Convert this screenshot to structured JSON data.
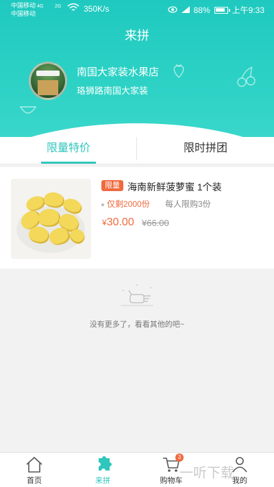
{
  "status_bar": {
    "carrier_1": "中国移动",
    "carrier_2": "中国移动",
    "signal_1": "4G",
    "signal_2": "2G",
    "speed": "350K/s",
    "battery": "88%",
    "time": "上午9:33"
  },
  "header": {
    "title": "来拼",
    "store_name": "南国大家装水果店",
    "store_address": "珞狮路南国大家装"
  },
  "tabs": [
    {
      "label": "限量特价",
      "active": true
    },
    {
      "label": "限时拼团",
      "active": false
    }
  ],
  "product": {
    "badge": "限量",
    "title": "海南新鲜菠萝蜜 1个装",
    "remaining": "仅剩2000份",
    "limit": "每人限购3份",
    "currency": "¥",
    "price": "30.00",
    "original_price": "¥66.00"
  },
  "empty_state": {
    "text": "没有更多了，看看其他的吧~",
    "icon": "pointing-hand-icon"
  },
  "bottom_nav": {
    "items": [
      {
        "label": "首页",
        "icon": "home-icon",
        "active": false
      },
      {
        "label": "来拼",
        "icon": "puzzle-icon",
        "active": true
      },
      {
        "label": "购物车",
        "icon": "cart-icon",
        "active": false,
        "badge": "3"
      },
      {
        "label": "我的",
        "icon": "user-icon",
        "active": false
      }
    ]
  },
  "watermark": "一听下载",
  "colors": {
    "accent": "#2fc6bc",
    "price": "#ef6a3f",
    "header_bg": "#1fc9bf"
  }
}
